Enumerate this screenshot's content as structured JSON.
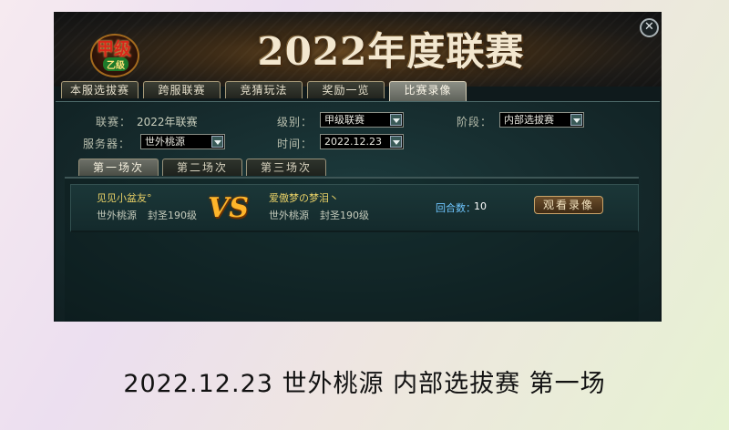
{
  "window": {
    "close_symbol": "✕",
    "banner_title": "2022年度联赛",
    "logo_text_big": "甲级",
    "logo_text_small": "乙级"
  },
  "main_tabs": [
    {
      "label": "本服选拔赛",
      "active": false
    },
    {
      "label": "跨服联赛",
      "active": false
    },
    {
      "label": "竞猜玩法",
      "active": false
    },
    {
      "label": "奖励一览",
      "active": false
    },
    {
      "label": "比赛录像",
      "active": true
    }
  ],
  "filters": {
    "league_label": "联赛：",
    "league_value": "2022年联赛",
    "level_label": "级别：",
    "level_value": "甲级联赛",
    "stage_label": "阶段：",
    "stage_value": "内部选拔赛",
    "server_label": "服务器：",
    "server_value": "世外桃源",
    "time_label": "时间：",
    "time_value": "2022.12.23"
  },
  "sub_tabs": [
    {
      "label": "第一场次",
      "active": true
    },
    {
      "label": "第二场次",
      "active": false
    },
    {
      "label": "第三场次",
      "active": false
    }
  ],
  "match": {
    "player1": {
      "name": "见见小盆友°",
      "server": "世外桃源",
      "title": "封圣190级"
    },
    "player2": {
      "name": "爱傲梦の梦泪丶",
      "server": "世外桃源",
      "title": "封圣190级"
    },
    "vs_text": "VS",
    "rounds_label": "回合数：",
    "rounds_value": "10",
    "watch_button": "观看录像"
  },
  "caption": "2022.12.23 世外桃源 内部选拔赛 第一场",
  "colors": {
    "accent_gold": "#e8d066",
    "rounds_blue": "#6fc6ff",
    "vs_orange": "#ffb52a"
  }
}
